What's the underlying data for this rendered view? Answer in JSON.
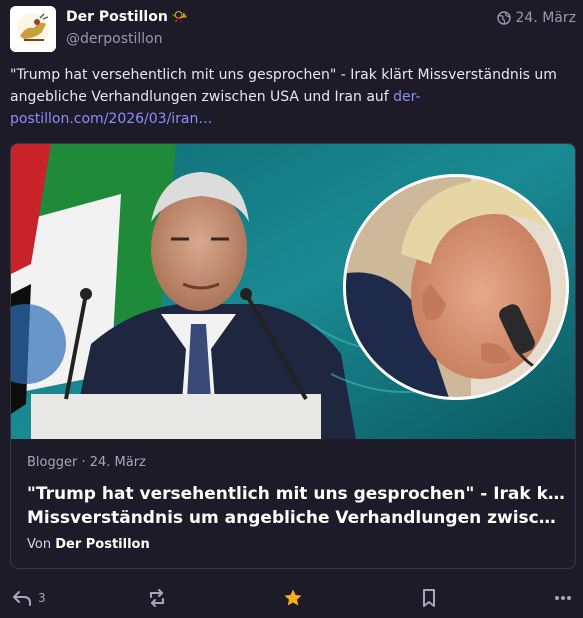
{
  "author": {
    "display_name": "Der Postillon",
    "name_emoji": "📯",
    "handle": "@derpostillon",
    "avatar_icon": "postillon-logo-icon"
  },
  "meta": {
    "visibility_icon": "globe-icon",
    "date": "24. März"
  },
  "post": {
    "text": "\"Trump hat versehentlich mit uns gesprochen\" - Irak klärt Missverständnis um angebliche Verhandlungen zwischen USA und Iran auf ",
    "link_text": "der-postillon.com/2026/03/iran…"
  },
  "card": {
    "source": "Blogger · 24. März",
    "title_line1": "\"Trump hat versehentlich mit uns gesprochen\" - Irak klärt",
    "title_line2": "Missverständnis um angebliche Verhandlungen zwischen USA und Iran auf",
    "author_prefix": "Von ",
    "author_name": "Der Postillon"
  },
  "actions": {
    "reply_count": "3"
  },
  "colors": {
    "background": "#1d1b27",
    "link": "#8c8dff",
    "favourite_active": "#f7b01b",
    "muted": "#9b97ad"
  }
}
